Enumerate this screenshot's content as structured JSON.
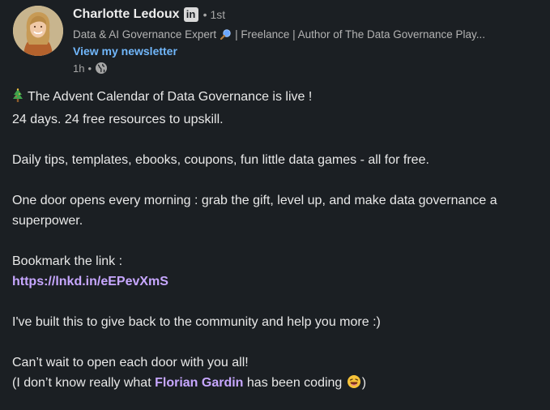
{
  "author": {
    "name": "Charlotte Ledoux",
    "badge": "in",
    "degree": "1st",
    "headline_prefix": "Data & AI Governance Expert",
    "headline_suffix": "| Freelance | Author of The Data Governance Play...",
    "newsletter_label": "View my newsletter",
    "time_ago": "1h",
    "visibility_icon": "globe-icon"
  },
  "post": {
    "line1": "The Advent Calendar of Data Governance is live !",
    "line2": "24 days. 24 free resources to upskill.",
    "line3": "Daily tips, templates, ebooks, coupons, fun little data games - all for free.",
    "line4": "One door opens every morning : grab the gift, level up, and make data governance a superpower.",
    "line5": "Bookmark the link :",
    "link": "https://lnkd.in/eEPevXmS",
    "line6": "I've built this to give back to the community and help you more :)",
    "line7": "Can’t wait to open each door with you all!",
    "line8_prefix": "(I don’t know really what",
    "mention": "Florian Gardin",
    "line8_suffix": "has been coding",
    "line8_close": ")",
    "leading_icon": "christmas-tree-icon",
    "trailing_icon": "laughing-face-icon"
  },
  "colors": {
    "background": "#1b1f23",
    "text": "#e8e8e8",
    "muted": "#a6a6a6",
    "newsletter": "#71b7fb",
    "link": "#c7a7ff"
  }
}
